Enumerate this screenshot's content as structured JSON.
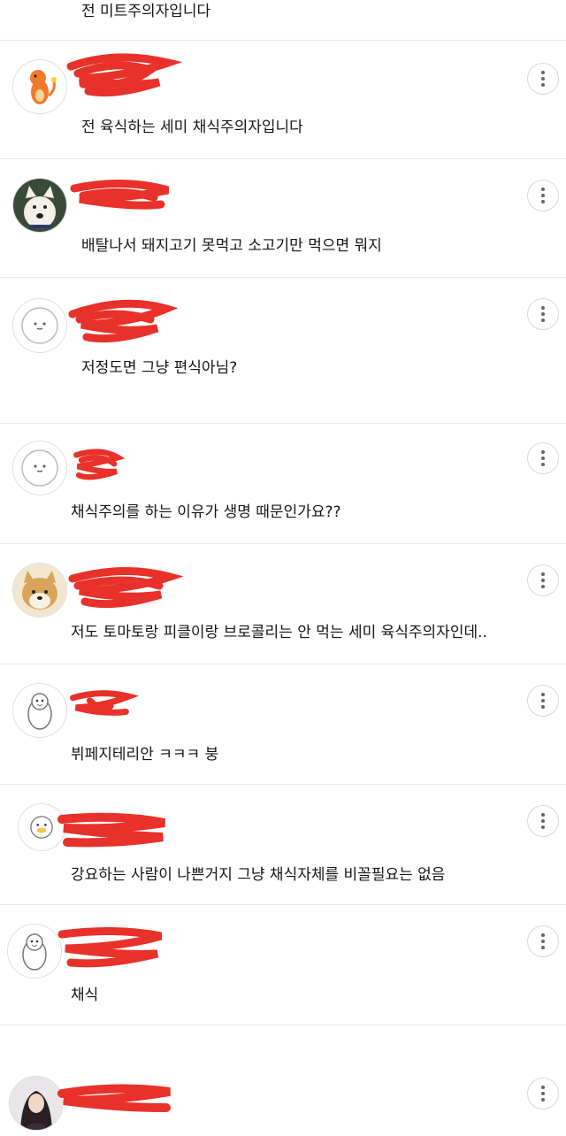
{
  "comments": [
    {
      "text": "전 미트주의자입니다"
    },
    {
      "text": "전 육식하는 세미 채식주의자입니다",
      "avatar": "charmander-avatar"
    },
    {
      "text": "배탈나서 돼지고기 못먹고 소고기만 먹으면 뭐지",
      "avatar": "white-dog-avatar"
    },
    {
      "text": "저정도면 그냥 편식아님?",
      "avatar": "default-face-avatar"
    },
    {
      "text": "채식주의를 하는 이유가 생명 때문인가요??",
      "avatar": "default-face-avatar"
    },
    {
      "text": "저도 토마토랑 피클이랑 브로콜리는 안 먹는 세미 육식주의자인데..",
      "avatar": "shiba-avatar"
    },
    {
      "text": "뷔페지테리안 ㅋㅋㅋ 붕",
      "avatar": "penguin-avatar"
    },
    {
      "text": "강요하는 사람이 나쁜거지 그냥 채식자체를 비꼴필요는 없음",
      "avatar": "duck-avatar"
    },
    {
      "text": "채식",
      "avatar": "penguin-avatar"
    },
    {
      "text": "",
      "avatar": "photo-avatar"
    }
  ],
  "icons": {
    "more": "more-vertical-icon"
  },
  "colors": {
    "redaction": "#e8312a",
    "divider": "#e7e7e7"
  }
}
